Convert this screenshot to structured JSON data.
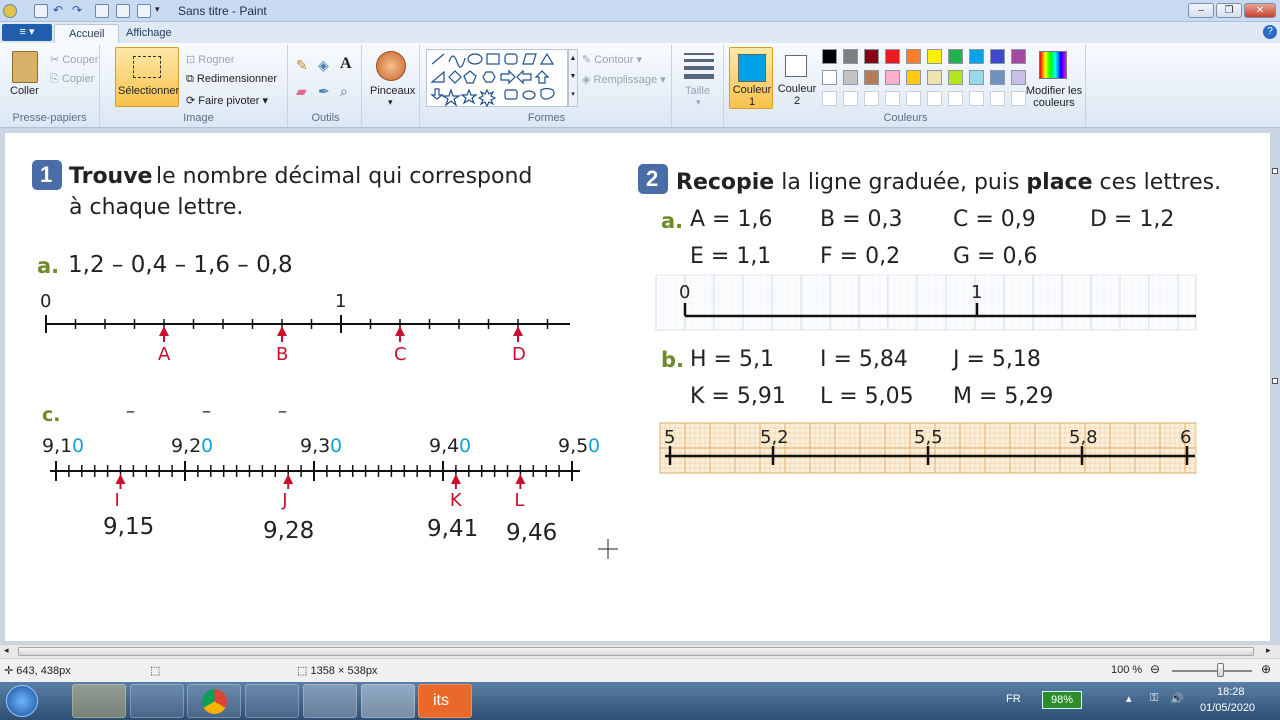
{
  "window": {
    "title": "Sans titre - Paint",
    "minimize": "–",
    "maximize": "❐",
    "close": "✕"
  },
  "tabs": {
    "file": "≡ ▾",
    "home": "Accueil",
    "view": "Affichage",
    "help": "?"
  },
  "ribbon": {
    "clipboard": {
      "paste": "Coller",
      "cut": "Couper",
      "copy": "Copier",
      "label": "Presse-papiers"
    },
    "image": {
      "select": "Sélectionner",
      "crop": "Rogner",
      "resize": "Redimensionner",
      "rotate": "Faire pivoter",
      "label": "Image"
    },
    "tools": {
      "label": "Outils",
      "text_tool": "A"
    },
    "brushes": {
      "label": "Pinceaux"
    },
    "shapes": {
      "outline": "Contour",
      "fill": "Remplissage",
      "label": "Formes"
    },
    "size": {
      "label": "Taille"
    },
    "colors": {
      "color1": "Couleur 1",
      "color2": "Couleur 2",
      "edit": "Modifier les couleurs",
      "label": "Couleurs",
      "color1_value": "#00a2e8",
      "color2_value": "#ffffff",
      "palette_row1": [
        "#000000",
        "#7f7f7f",
        "#880015",
        "#ed1c24",
        "#ff7f27",
        "#fff200",
        "#22b14c",
        "#00a2e8",
        "#3f48cc",
        "#a349a4"
      ],
      "palette_row2": [
        "#ffffff",
        "#c3c3c3",
        "#b97a57",
        "#ffaec9",
        "#ffc90e",
        "#efe4b0",
        "#b5e61d",
        "#99d9ea",
        "#7092be",
        "#c8bfe7"
      ]
    }
  },
  "exercise1": {
    "number": "1",
    "title_bold": "Trouve",
    "title_rest": "le nombre décimal qui correspond",
    "title_line2": "à chaque lettre.",
    "a": {
      "letter": "a.",
      "text": "1,2 – 0,4 – 1,6 – 0,8",
      "axis_start": "0",
      "axis_mark": "1",
      "labels": [
        "A",
        "B",
        "C",
        "D"
      ]
    },
    "c": {
      "letter": "c.",
      "dashes": [
        "–",
        "–",
        "–"
      ],
      "ticks": [
        {
          "main": "9,1",
          "suffix": "0"
        },
        {
          "main": "9,2",
          "suffix": "0"
        },
        {
          "main": "9,3",
          "suffix": "0"
        },
        {
          "main": "9,4",
          "suffix": "0"
        },
        {
          "main": "9,5",
          "suffix": "0"
        }
      ],
      "labels": [
        "I",
        "J",
        "K",
        "L"
      ],
      "answers": [
        "9,15",
        "9,28",
        "9,41",
        "9,46"
      ]
    }
  },
  "exercise2": {
    "number": "2",
    "title_bold1": "Recopie",
    "title_mid": "la ligne graduée, puis",
    "title_bold2": "place",
    "title_end": "ces lettres.",
    "a": {
      "letter": "a.",
      "row1": [
        "A = 1,6",
        "B = 0,3",
        "C = 0,9",
        "D = 1,2"
      ],
      "row2": [
        "E = 1,1",
        "F = 0,2",
        "G = 0,6"
      ],
      "axis": [
        "0",
        "1"
      ]
    },
    "b": {
      "letter": "b.",
      "row1": [
        "H = 5,1",
        "I = 5,84",
        "J = 5,18"
      ],
      "row2": [
        "K = 5,91",
        "L = 5,05",
        "M = 5,29"
      ],
      "axis": [
        "5",
        "5,2",
        "5,5",
        "5,8",
        "6"
      ]
    }
  },
  "status": {
    "cursor": "643, 438px",
    "size": "1358 × 538px",
    "zoom": "100 %",
    "zoom_fraction": 0.5
  },
  "taskbar": {
    "lang": "FR",
    "battery": "98%",
    "time": "18:28",
    "date": "01/05/2020",
    "app_its": "its"
  }
}
